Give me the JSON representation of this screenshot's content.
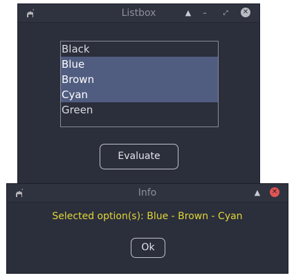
{
  "listbox_window": {
    "title": "Listbox",
    "items": [
      {
        "label": "Black",
        "selected": false
      },
      {
        "label": "Blue",
        "selected": true
      },
      {
        "label": "Brown",
        "selected": true
      },
      {
        "label": "Cyan",
        "selected": true
      },
      {
        "label": "Green",
        "selected": false
      }
    ],
    "evaluate_label": "Evaluate"
  },
  "info_dialog": {
    "title": "Info",
    "message": "Selected option(s): Blue - Brown - Cyan",
    "ok_label": "Ok"
  },
  "colors": {
    "window_bg": "#2b2e3b",
    "selection_bg": "#505c80",
    "message_text": "#e1d73a",
    "close_red": "#e05555",
    "close_gray": "#b8bac2"
  },
  "icons": {
    "app": "camel-icon",
    "shade": "triangle-up-icon",
    "minimize": "minimize-icon",
    "maximize": "maximize-icon",
    "close": "close-icon"
  }
}
